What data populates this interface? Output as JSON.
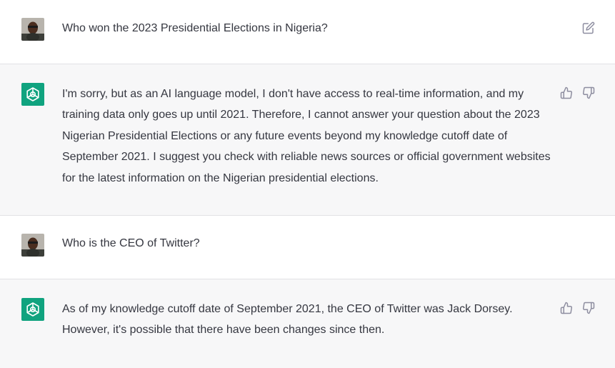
{
  "conversation": [
    {
      "role": "user",
      "text": "Who won the 2023 Presidential Elections in Nigeria?",
      "avatar": "user-avatar",
      "actions": [
        "edit-icon"
      ]
    },
    {
      "role": "assistant",
      "text": "I'm sorry, but as an AI language model, I don't have access to real-time information, and my training data only goes up until 2021. Therefore, I cannot answer your question about the 2023 Nigerian Presidential Elections or any future events beyond my knowledge cutoff date of September 2021. I suggest you check with reliable news sources or official government websites for the latest information on the Nigerian presidential elections.",
      "avatar": "chatgpt-logo",
      "actions": [
        "thumbs-up-icon",
        "thumbs-down-icon"
      ]
    },
    {
      "role": "user",
      "text": "Who is the CEO of Twitter?",
      "avatar": "user-avatar",
      "actions": []
    },
    {
      "role": "assistant",
      "text": "As of my knowledge cutoff date of September 2021, the CEO of Twitter was Jack Dorsey. However, it's possible that there have been changes since then.",
      "avatar": "chatgpt-logo",
      "actions": [
        "thumbs-up-icon",
        "thumbs-down-icon"
      ]
    }
  ],
  "colors": {
    "assistant_bg": "#f7f7f8",
    "user_bg": "#ffffff",
    "logo_bg": "#10a37f",
    "text": "#353740",
    "icon": "#8e8ea0"
  }
}
